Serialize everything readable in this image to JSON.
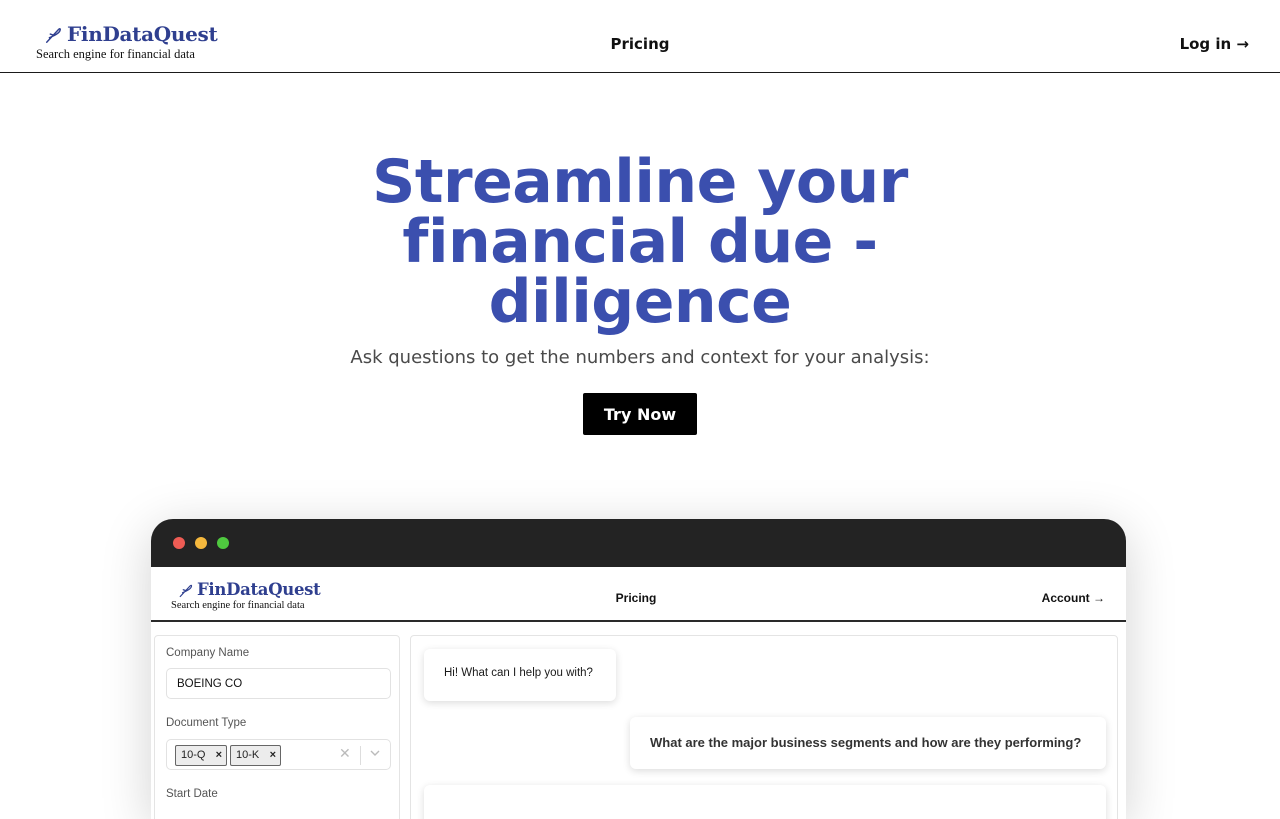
{
  "brand": {
    "name": "FinDataQuest",
    "tagline": "Search engine for financial data",
    "color": "#2f3f8f"
  },
  "nav": {
    "pricing": "Pricing",
    "login": "Log in →"
  },
  "hero": {
    "title": "Streamline your financial due - diligence",
    "subtitle": "Ask questions to get the numbers and context for your analysis:",
    "cta": "Try Now",
    "title_color": "#3b4fae"
  },
  "mock_app": {
    "nav": {
      "pricing": "Pricing",
      "account": "Account →"
    },
    "filters": {
      "company_label": "Company Name",
      "company_value": "BOEING CO",
      "doctype_label": "Document Type",
      "doctype_chips": [
        "10-Q",
        "10-K"
      ],
      "start_date_label": "Start Date"
    },
    "chat": {
      "bot_greeting": "Hi! What can I help you with?",
      "user_question": "What are the major business segments and how are they performing?"
    }
  },
  "icons": [
    "quill-logo-icon",
    "chip-remove-icon",
    "clear-icon",
    "chevron-down-icon"
  ]
}
